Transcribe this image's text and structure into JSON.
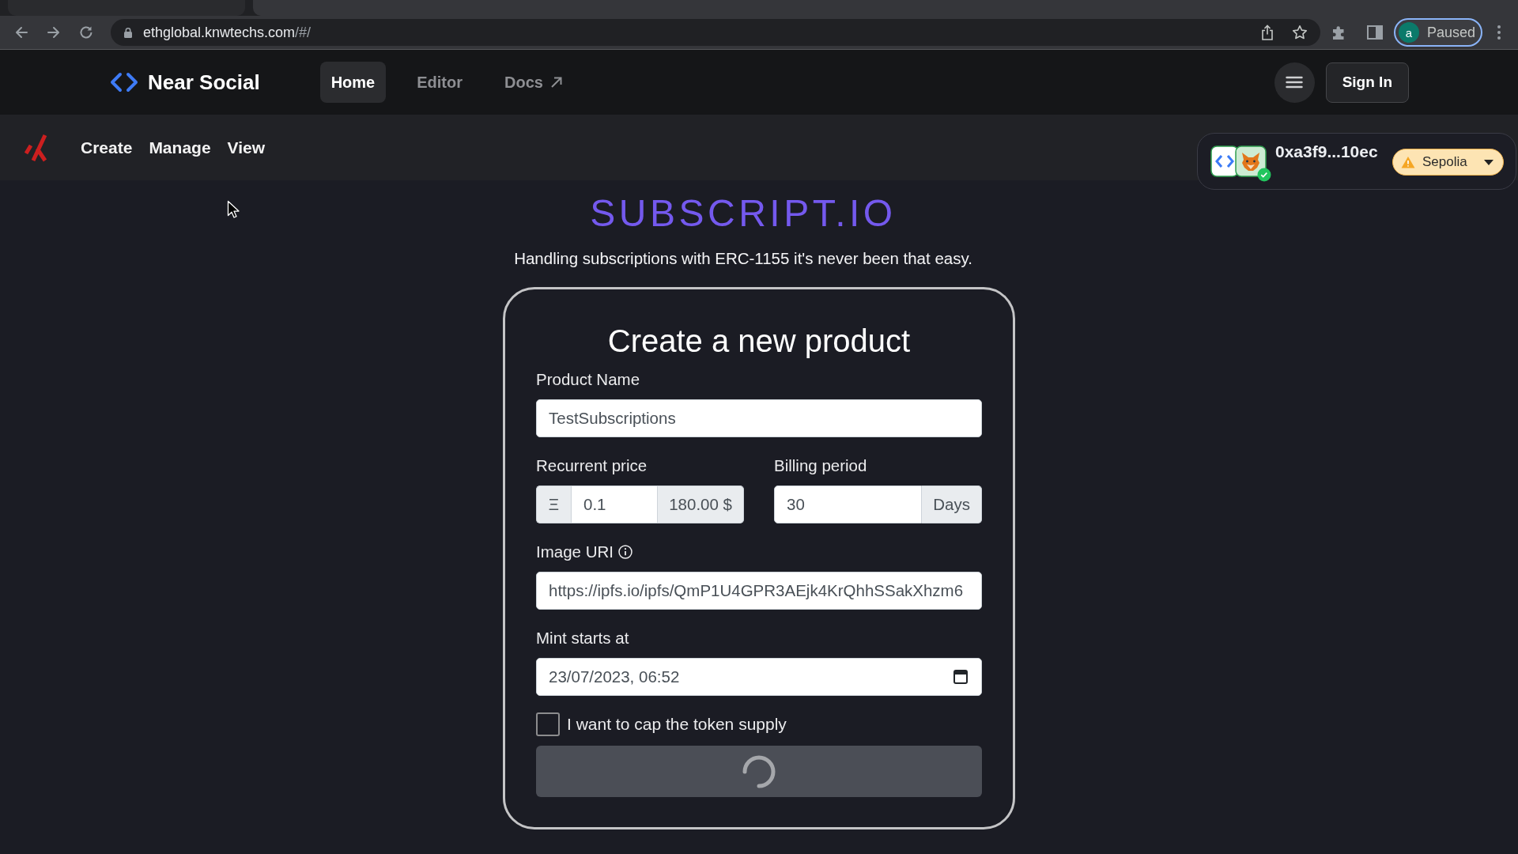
{
  "browser": {
    "url": {
      "host": "ethglobal.knwtechs.com",
      "path": "/#/"
    },
    "profile": {
      "initial": "a",
      "status": "Paused"
    }
  },
  "top_nav": {
    "brand": "Near Social",
    "links": [
      {
        "label": "Home",
        "selected": true,
        "external": false
      },
      {
        "label": "Editor",
        "selected": false,
        "external": false
      },
      {
        "label": "Docs",
        "selected": false,
        "external": true
      }
    ],
    "sign_in": "Sign In"
  },
  "sub_nav": {
    "links": [
      "Create",
      "Manage",
      "View"
    ]
  },
  "wallet": {
    "address": "0xa3f9...10ec",
    "connected": true,
    "network": {
      "name": "Sepolia",
      "warning": true
    }
  },
  "hero": {
    "title": "SUBSCRIPT.IO",
    "subtitle": "Handling subscriptions with ERC-1155 it's never been that easy."
  },
  "form": {
    "title": "Create a new product",
    "fields": [
      {
        "kind": "text",
        "label": "Product Name",
        "value": "TestSubscriptions"
      },
      {
        "kind": "row",
        "items": [
          {
            "kind": "group",
            "label": "Recurrent price",
            "prefix": "Ξ",
            "value": "0.1",
            "suffix": "180.00 $"
          },
          {
            "kind": "group",
            "label": "Billing period",
            "value": "30",
            "suffix": "Days"
          }
        ]
      },
      {
        "kind": "text",
        "label": "Image URI",
        "info": true,
        "value": "https://ipfs.io/ipfs/QmP1U4GPR3AEjk4KrQhhSSakXhzm6"
      },
      {
        "kind": "date",
        "label": "Mint starts at",
        "value": "23/07/2023, 06:52"
      }
    ],
    "checkbox": {
      "label": "I want to cap the token supply",
      "checked": false
    },
    "submit": {
      "loading": true
    }
  }
}
